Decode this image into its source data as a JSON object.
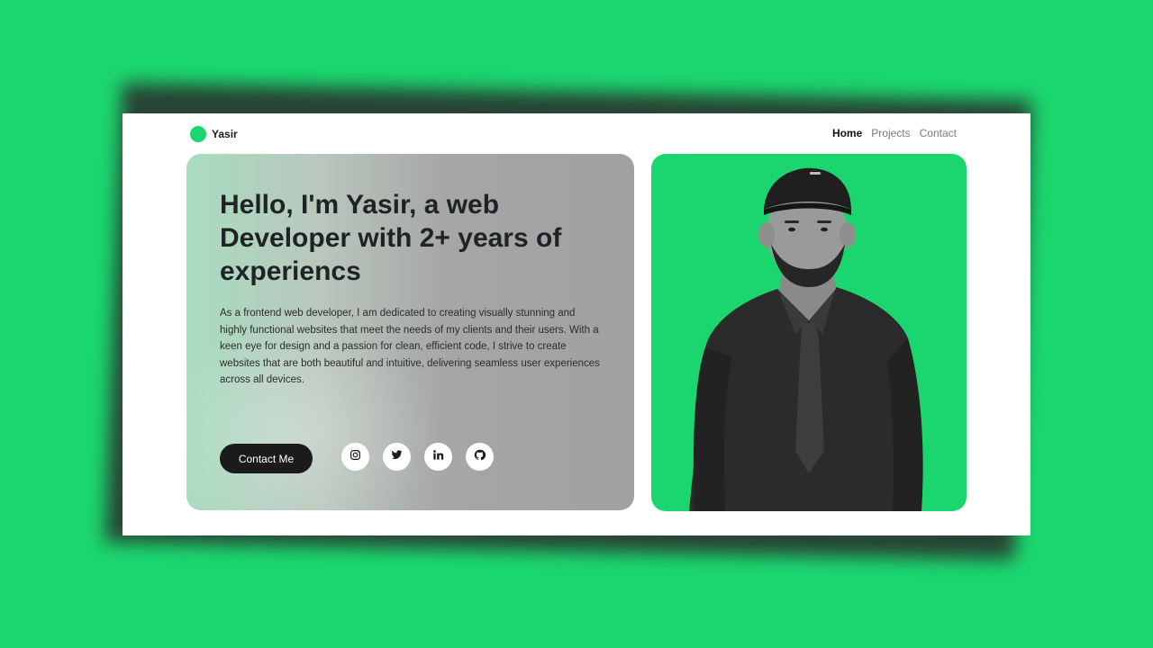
{
  "brand": {
    "name": "Yasir",
    "accent": "#1bd66f"
  },
  "nav": {
    "items": [
      "Home",
      "Projects",
      "Contact"
    ],
    "active": "Home"
  },
  "hero": {
    "title": "Hello, I'm Yasir, a web Developer with 2+ years of experiencs",
    "description": "As a frontend web developer, I am dedicated to creating visually stunning and highly functional websites that meet the needs of my clients and their users. With a keen eye for design and a passion for clean, efficient code, I strive to create websites that are both beautiful and intuitive, delivering seamless user experiences across all devices.",
    "cta_label": "Contact Me"
  },
  "socials": [
    {
      "icon": "instagram-icon"
    },
    {
      "icon": "twitter-icon"
    },
    {
      "icon": "linkedin-icon"
    },
    {
      "icon": "github-icon"
    }
  ],
  "portrait": {
    "icon": "profile-photo",
    "background": "#1bd66f"
  },
  "colors": {
    "background": "#1bd66f",
    "dark": "#1b1b1b",
    "card": "#ffffff"
  }
}
